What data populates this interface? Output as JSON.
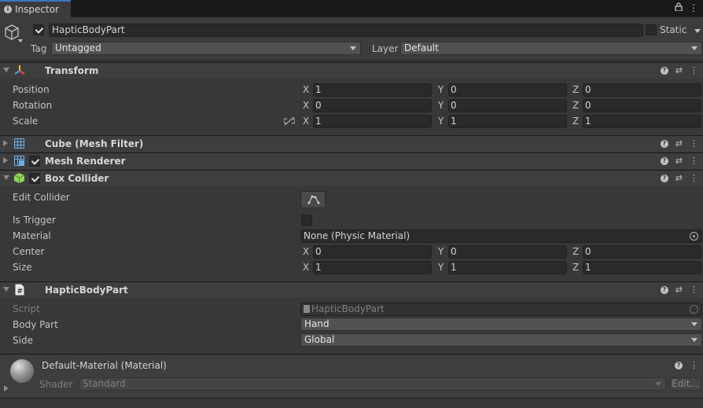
{
  "tab": {
    "title": "Inspector"
  },
  "object": {
    "name": "HapticBodyPart",
    "active": true,
    "static_label": "Static",
    "tag_label": "Tag",
    "tag_value": "Untagged",
    "layer_label": "Layer",
    "layer_value": "Default"
  },
  "transform": {
    "title": "Transform",
    "rows": [
      {
        "label": "Position",
        "x": "1",
        "y": "0",
        "z": "0"
      },
      {
        "label": "Rotation",
        "x": "0",
        "y": "0",
        "z": "0"
      },
      {
        "label": "Scale",
        "x": "1",
        "y": "1",
        "z": "1"
      }
    ]
  },
  "axes": {
    "x": "X",
    "y": "Y",
    "z": "Z"
  },
  "mesh_filter": {
    "title": "Cube (Mesh Filter)"
  },
  "mesh_renderer": {
    "title": "Mesh Renderer",
    "enabled": true
  },
  "box_collider": {
    "title": "Box Collider",
    "enabled": true,
    "edit_collider_label": "Edit Collider",
    "is_trigger_label": "Is Trigger",
    "material_label": "Material",
    "material_value": "None (Physic Material)",
    "center": {
      "label": "Center",
      "x": "0",
      "y": "0",
      "z": "0"
    },
    "size": {
      "label": "Size",
      "x": "1",
      "y": "1",
      "z": "1"
    }
  },
  "script_comp": {
    "title": "HapticBodyPart",
    "script_label": "Script",
    "script_value": "HapticBodyPart",
    "body_part_label": "Body Part",
    "body_part_value": "Hand",
    "side_label": "Side",
    "side_value": "Global"
  },
  "material": {
    "title": "Default-Material (Material)",
    "shader_label": "Shader",
    "shader_value": "Standard",
    "edit_label": "Edit..."
  },
  "colors": {
    "background": "#383838",
    "header": "#3e3e3e",
    "field": "#2a2a2a",
    "tab_accent": "#3a79bb"
  }
}
